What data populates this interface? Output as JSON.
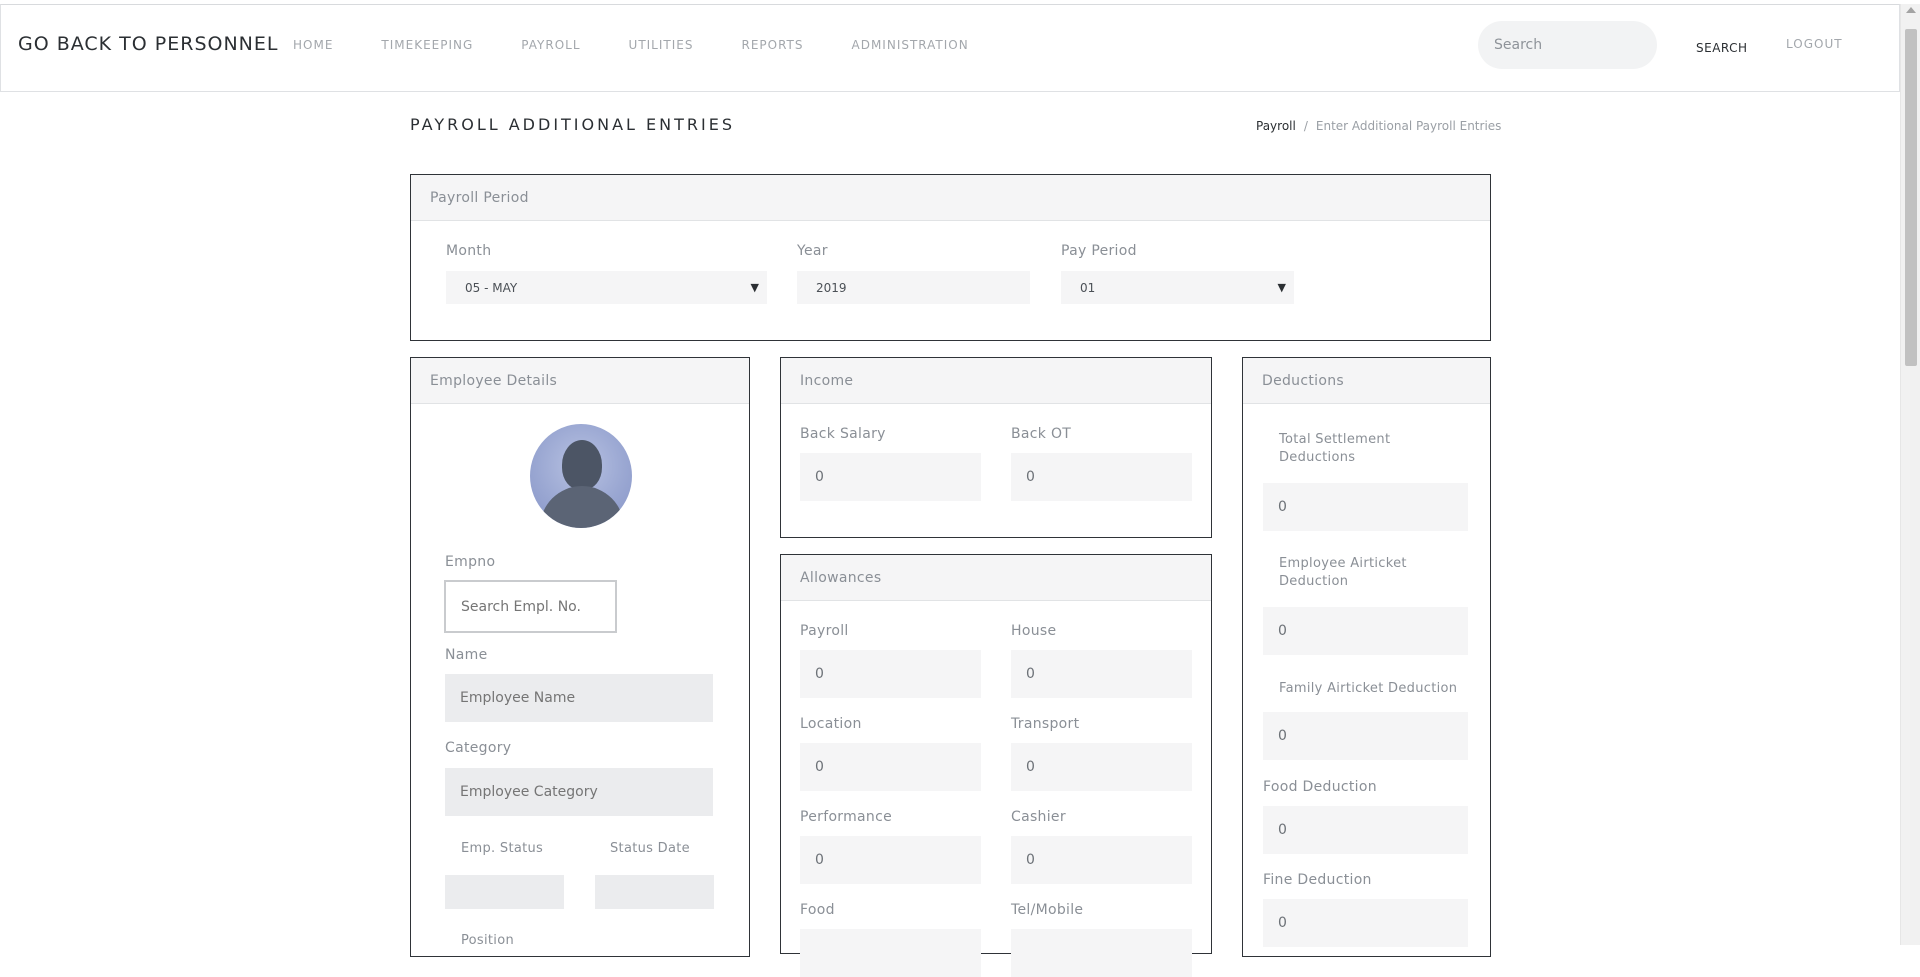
{
  "header": {
    "brand": "GO BACK TO PERSONNEL",
    "nav": [
      "HOME",
      "TIMEKEEPING",
      "PAYROLL",
      "UTILITIES",
      "REPORTS",
      "ADMINISTRATION"
    ],
    "search_placeholder": "Search",
    "search_label": "SEARCH",
    "logout_label": "LOGOUT"
  },
  "page": {
    "title": "PAYROLL ADDITIONAL ENTRIES",
    "breadcrumb": {
      "parent": "Payroll",
      "separator": "/",
      "current": "Enter Additional Payroll Entries"
    }
  },
  "payroll_period": {
    "title": "Payroll Period",
    "month_label": "Month",
    "month_value": "05 - MAY",
    "year_label": "Year",
    "year_value": "2019",
    "pay_period_label": "Pay Period",
    "pay_period_value": "01",
    "caret": "▼"
  },
  "employee": {
    "title": "Employee Details",
    "empno_label": "Empno",
    "empno_placeholder": "Search Empl. No.",
    "name_label": "Name",
    "name_placeholder": "Employee Name",
    "category_label": "Category",
    "category_placeholder": "Employee Category",
    "status_label": "Emp. Status",
    "status_date_label": "Status Date",
    "position_label": "Position"
  },
  "income": {
    "title": "Income",
    "back_salary_label": "Back Salary",
    "back_salary_value": "0",
    "back_ot_label": "Back OT",
    "back_ot_value": "0"
  },
  "allowances": {
    "title": "Allowances",
    "payroll_label": "Payroll",
    "payroll_value": "0",
    "house_label": "House",
    "house_value": "0",
    "location_label": "Location",
    "location_value": "0",
    "transport_label": "Transport",
    "transport_value": "0",
    "performance_label": "Performance",
    "performance_value": "0",
    "cashier_label": "Cashier",
    "cashier_value": "0",
    "food_label": "Food",
    "tel_label": "Tel/Mobile"
  },
  "deductions": {
    "title": "Deductions",
    "total_settlement_label_1": "Total Settlement",
    "total_settlement_label_2": "Deductions",
    "total_settlement_value": "0",
    "emp_airticket_label_1": "Employee Airticket",
    "emp_airticket_label_2": "Deduction",
    "emp_airticket_value": "0",
    "family_airticket_label": "Family Airticket Deduction",
    "family_airticket_value": "0",
    "food_label": "Food Deduction",
    "food_value": "0",
    "fine_label": "Fine Deduction",
    "fine_value": "0"
  }
}
